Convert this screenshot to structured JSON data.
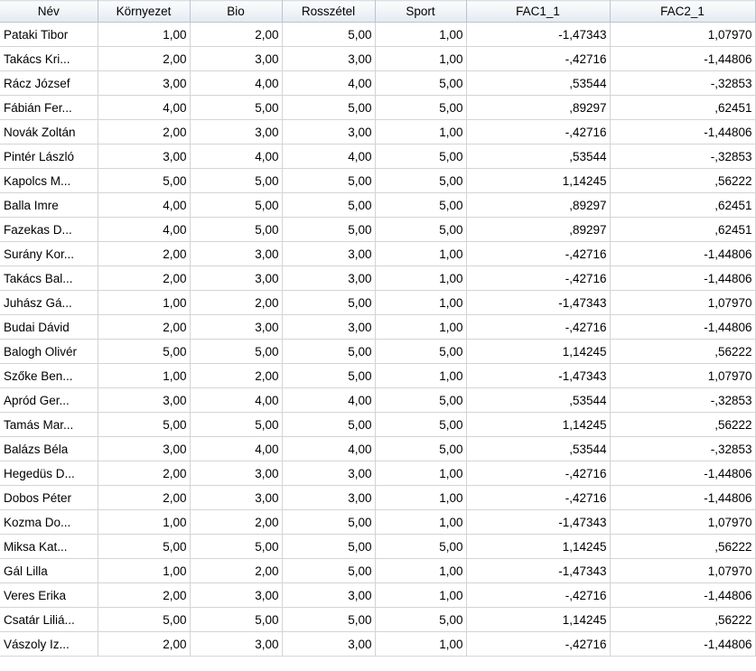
{
  "columns": [
    "Név",
    "Környezet",
    "Bio",
    "Rosszétel",
    "Sport",
    "FAC1_1",
    "FAC2_1"
  ],
  "rows": [
    [
      "Pataki Tibor",
      "1,00",
      "2,00",
      "5,00",
      "1,00",
      "-1,47343",
      "1,07970"
    ],
    [
      "Takács Kri...",
      "2,00",
      "3,00",
      "3,00",
      "1,00",
      "-,42716",
      "-1,44806"
    ],
    [
      "Rácz József",
      "3,00",
      "4,00",
      "4,00",
      "5,00",
      ",53544",
      "-,32853"
    ],
    [
      "Fábián Fer...",
      "4,00",
      "5,00",
      "5,00",
      "5,00",
      ",89297",
      ",62451"
    ],
    [
      "Novák Zoltán",
      "2,00",
      "3,00",
      "3,00",
      "1,00",
      "-,42716",
      "-1,44806"
    ],
    [
      "Pintér László",
      "3,00",
      "4,00",
      "4,00",
      "5,00",
      ",53544",
      "-,32853"
    ],
    [
      "Kapolcs M...",
      "5,00",
      "5,00",
      "5,00",
      "5,00",
      "1,14245",
      ",56222"
    ],
    [
      "Balla Imre",
      "4,00",
      "5,00",
      "5,00",
      "5,00",
      ",89297",
      ",62451"
    ],
    [
      "Fazekas D...",
      "4,00",
      "5,00",
      "5,00",
      "5,00",
      ",89297",
      ",62451"
    ],
    [
      "Surány Kor...",
      "2,00",
      "3,00",
      "3,00",
      "1,00",
      "-,42716",
      "-1,44806"
    ],
    [
      "Takács Bal...",
      "2,00",
      "3,00",
      "3,00",
      "1,00",
      "-,42716",
      "-1,44806"
    ],
    [
      "Juhász Gá...",
      "1,00",
      "2,00",
      "5,00",
      "1,00",
      "-1,47343",
      "1,07970"
    ],
    [
      "Budai Dávid",
      "2,00",
      "3,00",
      "3,00",
      "1,00",
      "-,42716",
      "-1,44806"
    ],
    [
      "Balogh Olivér",
      "5,00",
      "5,00",
      "5,00",
      "5,00",
      "1,14245",
      ",56222"
    ],
    [
      "Szőke Ben...",
      "1,00",
      "2,00",
      "5,00",
      "1,00",
      "-1,47343",
      "1,07970"
    ],
    [
      "Apród Ger...",
      "3,00",
      "4,00",
      "4,00",
      "5,00",
      ",53544",
      "-,32853"
    ],
    [
      "Tamás Mar...",
      "5,00",
      "5,00",
      "5,00",
      "5,00",
      "1,14245",
      ",56222"
    ],
    [
      "Balázs Béla",
      "3,00",
      "4,00",
      "4,00",
      "5,00",
      ",53544",
      "-,32853"
    ],
    [
      "Hegedüs D...",
      "2,00",
      "3,00",
      "3,00",
      "1,00",
      "-,42716",
      "-1,44806"
    ],
    [
      "Dobos Péter",
      "2,00",
      "3,00",
      "3,00",
      "1,00",
      "-,42716",
      "-1,44806"
    ],
    [
      "Kozma Do...",
      "1,00",
      "2,00",
      "5,00",
      "1,00",
      "-1,47343",
      "1,07970"
    ],
    [
      "Miksa Kat...",
      "5,00",
      "5,00",
      "5,00",
      "5,00",
      "1,14245",
      ",56222"
    ],
    [
      "Gál Lilla",
      "1,00",
      "2,00",
      "5,00",
      "1,00",
      "-1,47343",
      "1,07970"
    ],
    [
      "Veres Erika",
      "2,00",
      "3,00",
      "3,00",
      "1,00",
      "-,42716",
      "-1,44806"
    ],
    [
      "Csatár Liliá...",
      "5,00",
      "5,00",
      "5,00",
      "5,00",
      "1,14245",
      ",56222"
    ],
    [
      "Vászoly Iz...",
      "2,00",
      "3,00",
      "3,00",
      "1,00",
      "-,42716",
      "-1,44806"
    ]
  ]
}
